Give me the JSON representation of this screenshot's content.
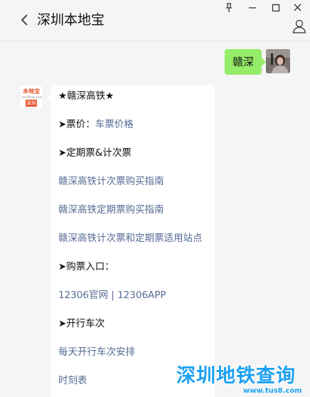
{
  "header": {
    "title": "深圳本地宝"
  },
  "chat": {
    "my_message": "赣深",
    "bot_card": {
      "title": "★赣深高铁★",
      "price_prefix": "➤票价：",
      "price_link": "车票价格",
      "periodic_heading": "➤定期票&计次票",
      "link_count_guide": "赣深高铁计次票购买指南",
      "link_periodic_guide": "赣深高铁定期票购买指南",
      "link_stations": "赣深高铁计次票和定期票适用站点",
      "purchase_heading": "➤购票入口：",
      "link_12306_web": "12306官网",
      "separator": " | ",
      "link_12306_app": "12306APP",
      "schedule_heading": "➤开行车次",
      "link_daily_schedule": "每天开行车次安排",
      "link_timetable": "时刻表"
    },
    "bot_avatar": {
      "top": "本地宝",
      "mid": "bendibao.com",
      "bottom": "深圳"
    }
  },
  "watermark": {
    "text": "深圳地铁查询",
    "url": "www.tus8.com"
  },
  "icons": {
    "back": "chevron-left-icon",
    "pin": "pin-icon",
    "minimize": "minimize-icon",
    "maximize": "maximize-icon",
    "close": "close-icon",
    "profile": "person-icon"
  },
  "colors": {
    "background": "#f5f5f5",
    "my_bubble": "#95ec69",
    "link": "#576b95",
    "watermark": "#1da1f2"
  }
}
